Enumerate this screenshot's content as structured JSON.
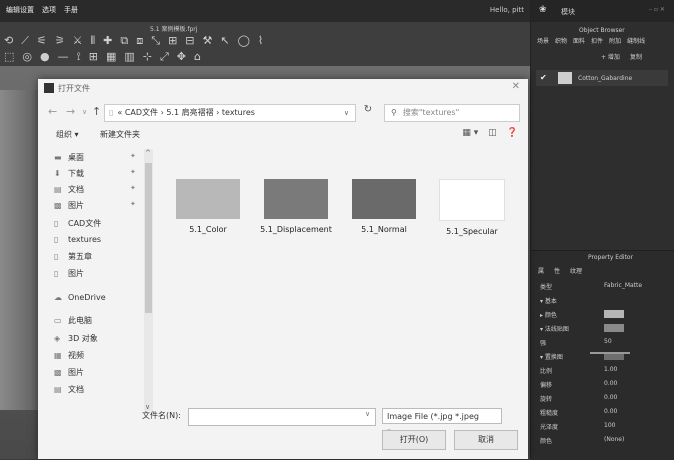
{
  "menubar": {
    "items": [
      "编辑设置",
      "选项",
      "手册"
    ],
    "user": "Hello, pitt"
  },
  "app_title": "5.1 案例模板.fprj",
  "right_panel": {
    "tab": "模块",
    "object_browser_title": "Object Browser",
    "ob_tabs": [
      "场景",
      "织物",
      "面料",
      "扣件",
      "附加",
      "缝制线"
    ],
    "ob_actions": [
      "+ 增加",
      "复制"
    ],
    "object_item": "Cotton_Gabardine",
    "property_editor_title": "Property Editor",
    "pe_tabs": [
      "属",
      "性",
      "纹理"
    ],
    "properties": [
      {
        "label": "类型",
        "value": "Fabric_Matte"
      },
      {
        "label": "▾ 基本",
        "value": ""
      },
      {
        "label": "▸ 颜色",
        "value": ""
      },
      {
        "label": "▾ 法线贴图",
        "value": ""
      },
      {
        "label": "强",
        "value": "50"
      },
      {
        "label": "▾ 置换图",
        "value": ""
      },
      {
        "label": "比例",
        "value": "1.00"
      },
      {
        "label": "偏移",
        "value": "0.00"
      },
      {
        "label": "旋转",
        "value": "0.00"
      },
      {
        "label": "粗糙度",
        "value": "0.00"
      },
      {
        "label": "光泽度",
        "value": "100"
      },
      {
        "label": "颜色",
        "value": "(None)"
      }
    ]
  },
  "dialog": {
    "title": "打开文件",
    "close": "✕",
    "address": "« CAD文件  ›  5.1 肩亮褶褶  ›  textures",
    "search_placeholder": "搜索\"textures\"",
    "organize": "组织 ▾",
    "new_folder": "新建文件夹",
    "sidebar": [
      {
        "label": "桌面",
        "icon": "desktop-icon",
        "glyph": "▬",
        "pinned": true
      },
      {
        "label": "下载",
        "icon": "download-icon",
        "glyph": "⬇",
        "pinned": true
      },
      {
        "label": "文档",
        "icon": "document-icon",
        "glyph": "▤",
        "pinned": true
      },
      {
        "label": "图片",
        "icon": "picture-icon",
        "glyph": "▩",
        "pinned": true
      },
      {
        "label": "CAD文件",
        "icon": "folder-icon",
        "glyph": "▯",
        "pinned": false
      },
      {
        "label": "textures",
        "icon": "folder-icon",
        "glyph": "▯",
        "pinned": false
      },
      {
        "label": "第五章",
        "icon": "folder-icon",
        "glyph": "▯",
        "pinned": false
      },
      {
        "label": "图片",
        "icon": "folder-icon",
        "glyph": "▯",
        "pinned": false
      },
      {
        "label": "OneDrive",
        "icon": "cloud-icon",
        "glyph": "☁",
        "pinned": false
      },
      {
        "label": "此电脑",
        "icon": "computer-icon",
        "glyph": "▭",
        "pinned": false
      },
      {
        "label": "3D 对象",
        "icon": "cube-icon",
        "glyph": "◈",
        "pinned": false
      },
      {
        "label": "视频",
        "icon": "video-icon",
        "glyph": "▦",
        "pinned": false
      },
      {
        "label": "图片",
        "icon": "picture-icon",
        "glyph": "▩",
        "pinned": false
      },
      {
        "label": "文档",
        "icon": "document-icon",
        "glyph": "▤",
        "pinned": false
      }
    ],
    "files": [
      {
        "name": "5.1_Color",
        "color": "#b8b8b8"
      },
      {
        "name": "5.1_Displacement",
        "color": "#7a7a7a"
      },
      {
        "name": "5.1_Normal",
        "color": "#6a6a6a"
      },
      {
        "name": "5.1_Specular",
        "color": "#ffffff"
      }
    ],
    "filename_label": "文件名(N):",
    "filename_value": "",
    "filetype": "Image File (*.jpg *.jpeg *.png ∨",
    "open": "打开(O)",
    "cancel": "取消"
  }
}
